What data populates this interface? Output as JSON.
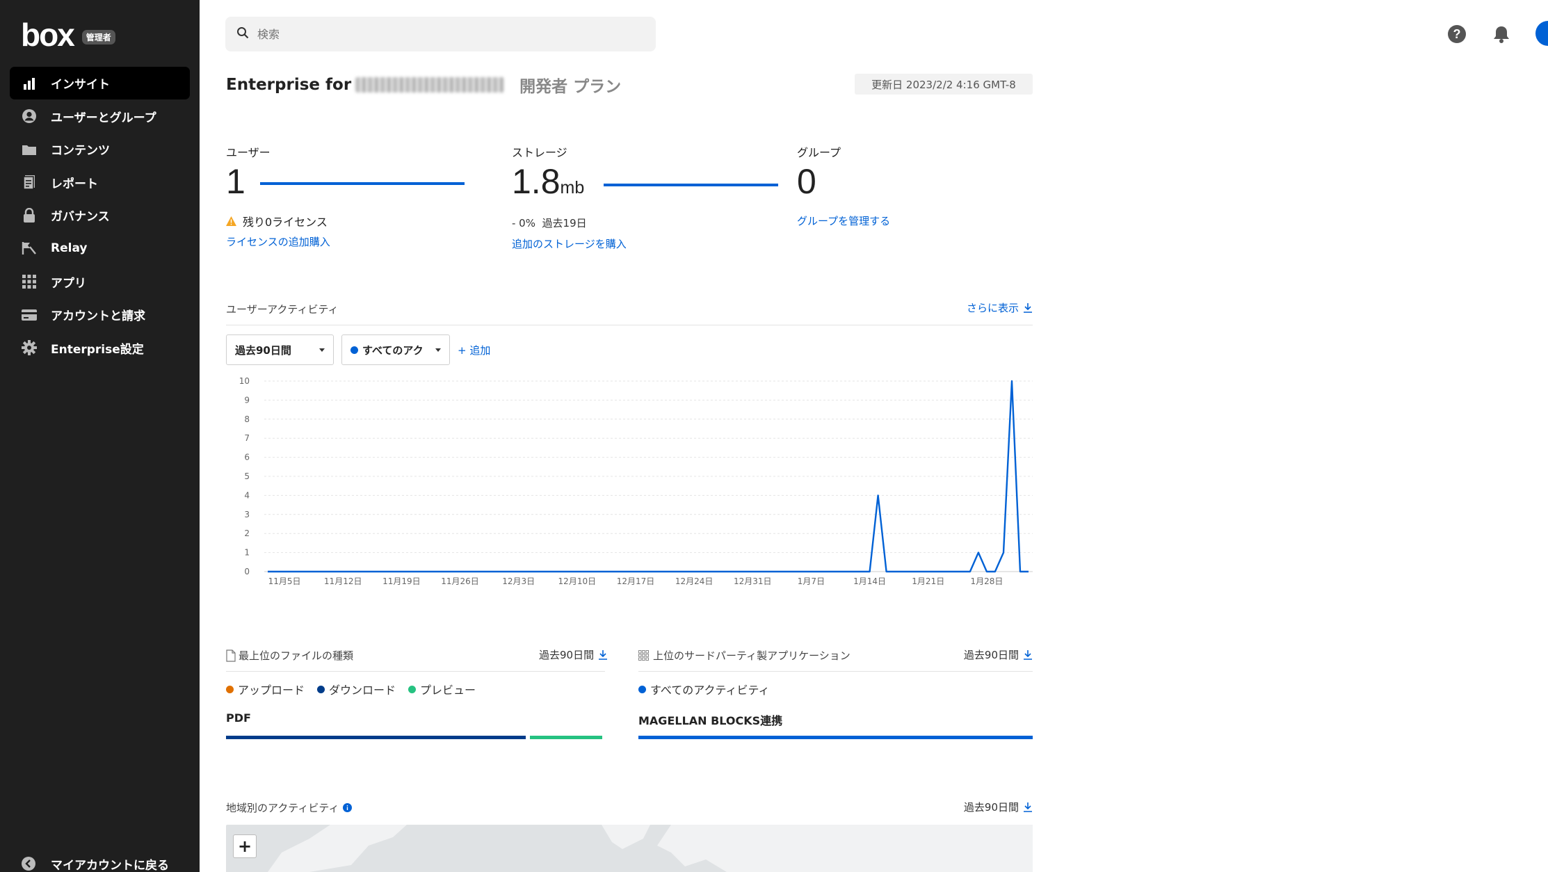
{
  "sidebar": {
    "logo": "box",
    "badge": "管理者",
    "items": [
      {
        "label": "インサイト",
        "icon": "bar-chart-icon",
        "active": true
      },
      {
        "label": "ユーザーとグループ",
        "icon": "user-circle-icon",
        "active": false
      },
      {
        "label": "コンテンツ",
        "icon": "folder-icon",
        "active": false
      },
      {
        "label": "レポート",
        "icon": "report-icon",
        "active": false
      },
      {
        "label": "ガバナンス",
        "icon": "lock-icon",
        "active": false
      },
      {
        "label": "Relay",
        "icon": "relay-flag-icon",
        "active": false
      },
      {
        "label": "アプリ",
        "icon": "apps-grid-icon",
        "active": false
      },
      {
        "label": "アカウントと請求",
        "icon": "credit-card-icon",
        "active": false
      },
      {
        "label": "Enterprise設定",
        "icon": "gear-icon",
        "active": false
      }
    ],
    "back_label": "マイアカウントに戻る"
  },
  "search": {
    "placeholder": "検索"
  },
  "header": {
    "title_prefix": "Enterprise for",
    "plan": "開発者 プラン",
    "updated": "更新日 2023/2/2 4:16 GMT-8"
  },
  "stats": {
    "users": {
      "label": "ユーザー",
      "value": "1",
      "warning": "残り0ライセンス",
      "link": "ライセンスの追加購入"
    },
    "storage": {
      "label": "ストレージ",
      "value": "1.8",
      "unit": "mb",
      "change": "- 0%",
      "period": "過去19日",
      "link": "追加のストレージを購入"
    },
    "groups": {
      "label": "グループ",
      "value": "0",
      "link": "グループを管理する"
    }
  },
  "activity": {
    "title": "ユーザーアクティビティ",
    "more": "さらに表示",
    "period_select": "過去90日間",
    "type_select": "すべてのアク",
    "add": "+ 追加"
  },
  "chart_data": {
    "type": "line",
    "title": "",
    "xlabel": "",
    "ylabel": "",
    "ylim": [
      0,
      10
    ],
    "yticks": [
      "0",
      "1",
      "2",
      "3",
      "4",
      "5",
      "6",
      "7",
      "8",
      "9",
      "10"
    ],
    "xticks": [
      "11月5日",
      "11月12日",
      "11月19日",
      "11月26日",
      "12月3日",
      "12月10日",
      "12月17日",
      "12月24日",
      "12月31日",
      "1月7日",
      "1月14日",
      "1月21日",
      "1月28日"
    ],
    "color": "#0061d5",
    "x": [
      "11/3",
      "11/4",
      "11/5",
      "11/6",
      "11/7",
      "11/8",
      "11/9",
      "11/10",
      "11/11",
      "11/12",
      "11/13",
      "11/14",
      "11/15",
      "11/16",
      "11/17",
      "11/18",
      "11/19",
      "11/20",
      "11/21",
      "11/22",
      "11/23",
      "11/24",
      "11/25",
      "11/26",
      "11/27",
      "11/28",
      "11/29",
      "11/30",
      "12/1",
      "12/2",
      "12/3",
      "12/4",
      "12/5",
      "12/6",
      "12/7",
      "12/8",
      "12/9",
      "12/10",
      "12/11",
      "12/12",
      "12/13",
      "12/14",
      "12/15",
      "12/16",
      "12/17",
      "12/18",
      "12/19",
      "12/20",
      "12/21",
      "12/22",
      "12/23",
      "12/24",
      "12/25",
      "12/26",
      "12/27",
      "12/28",
      "12/29",
      "12/30",
      "12/31",
      "1/1",
      "1/2",
      "1/3",
      "1/4",
      "1/5",
      "1/6",
      "1/7",
      "1/8",
      "1/9",
      "1/10",
      "1/11",
      "1/12",
      "1/13",
      "1/14",
      "1/15",
      "1/16",
      "1/17",
      "1/18",
      "1/19",
      "1/20",
      "1/21",
      "1/22",
      "1/23",
      "1/24",
      "1/25",
      "1/26",
      "1/27",
      "1/28",
      "1/29",
      "1/30",
      "1/31",
      "2/1"
    ],
    "series": [
      {
        "values": [
          0,
          0,
          0,
          0,
          0,
          0,
          0,
          0,
          0,
          0,
          0,
          0,
          0,
          0,
          0,
          0,
          0,
          0,
          0,
          0,
          0,
          0,
          0,
          0,
          0,
          0,
          0,
          0,
          0,
          0,
          0,
          0,
          0,
          0,
          0,
          0,
          0,
          0,
          0,
          0,
          0,
          0,
          0,
          0,
          0,
          0,
          0,
          0,
          0,
          0,
          0,
          0,
          0,
          0,
          0,
          0,
          0,
          0,
          0,
          0,
          0,
          0,
          0,
          0,
          0,
          0,
          0,
          0,
          0,
          0,
          0,
          0,
          0,
          4,
          0,
          0,
          0,
          0,
          0,
          0,
          0,
          0,
          0,
          0,
          0,
          1,
          0,
          0,
          1,
          10,
          0,
          0
        ]
      }
    ]
  },
  "file_types": {
    "title": "最上位のファイルの種類",
    "period": "過去90日間",
    "legend": [
      {
        "label": "アップロード",
        "color": "#e07000"
      },
      {
        "label": "ダウンロード",
        "color": "#003c8a"
      },
      {
        "label": "プレビュー",
        "color": "#26c281"
      }
    ],
    "rows": [
      {
        "label": "PDF",
        "download": 0.84,
        "preview": 0.2
      }
    ]
  },
  "third_party": {
    "title": "上位のサードパーティ製アプリケーション",
    "period": "過去90日間",
    "legend": [
      {
        "label": "すべてのアクティビティ",
        "color": "#0061d5"
      }
    ],
    "rows": [
      {
        "label": "MAGELLAN BLOCKS連携",
        "value": 1.0
      }
    ]
  },
  "geo": {
    "title": "地域別のアクティビティ",
    "period": "過去90日間",
    "zoom_in": "+"
  }
}
